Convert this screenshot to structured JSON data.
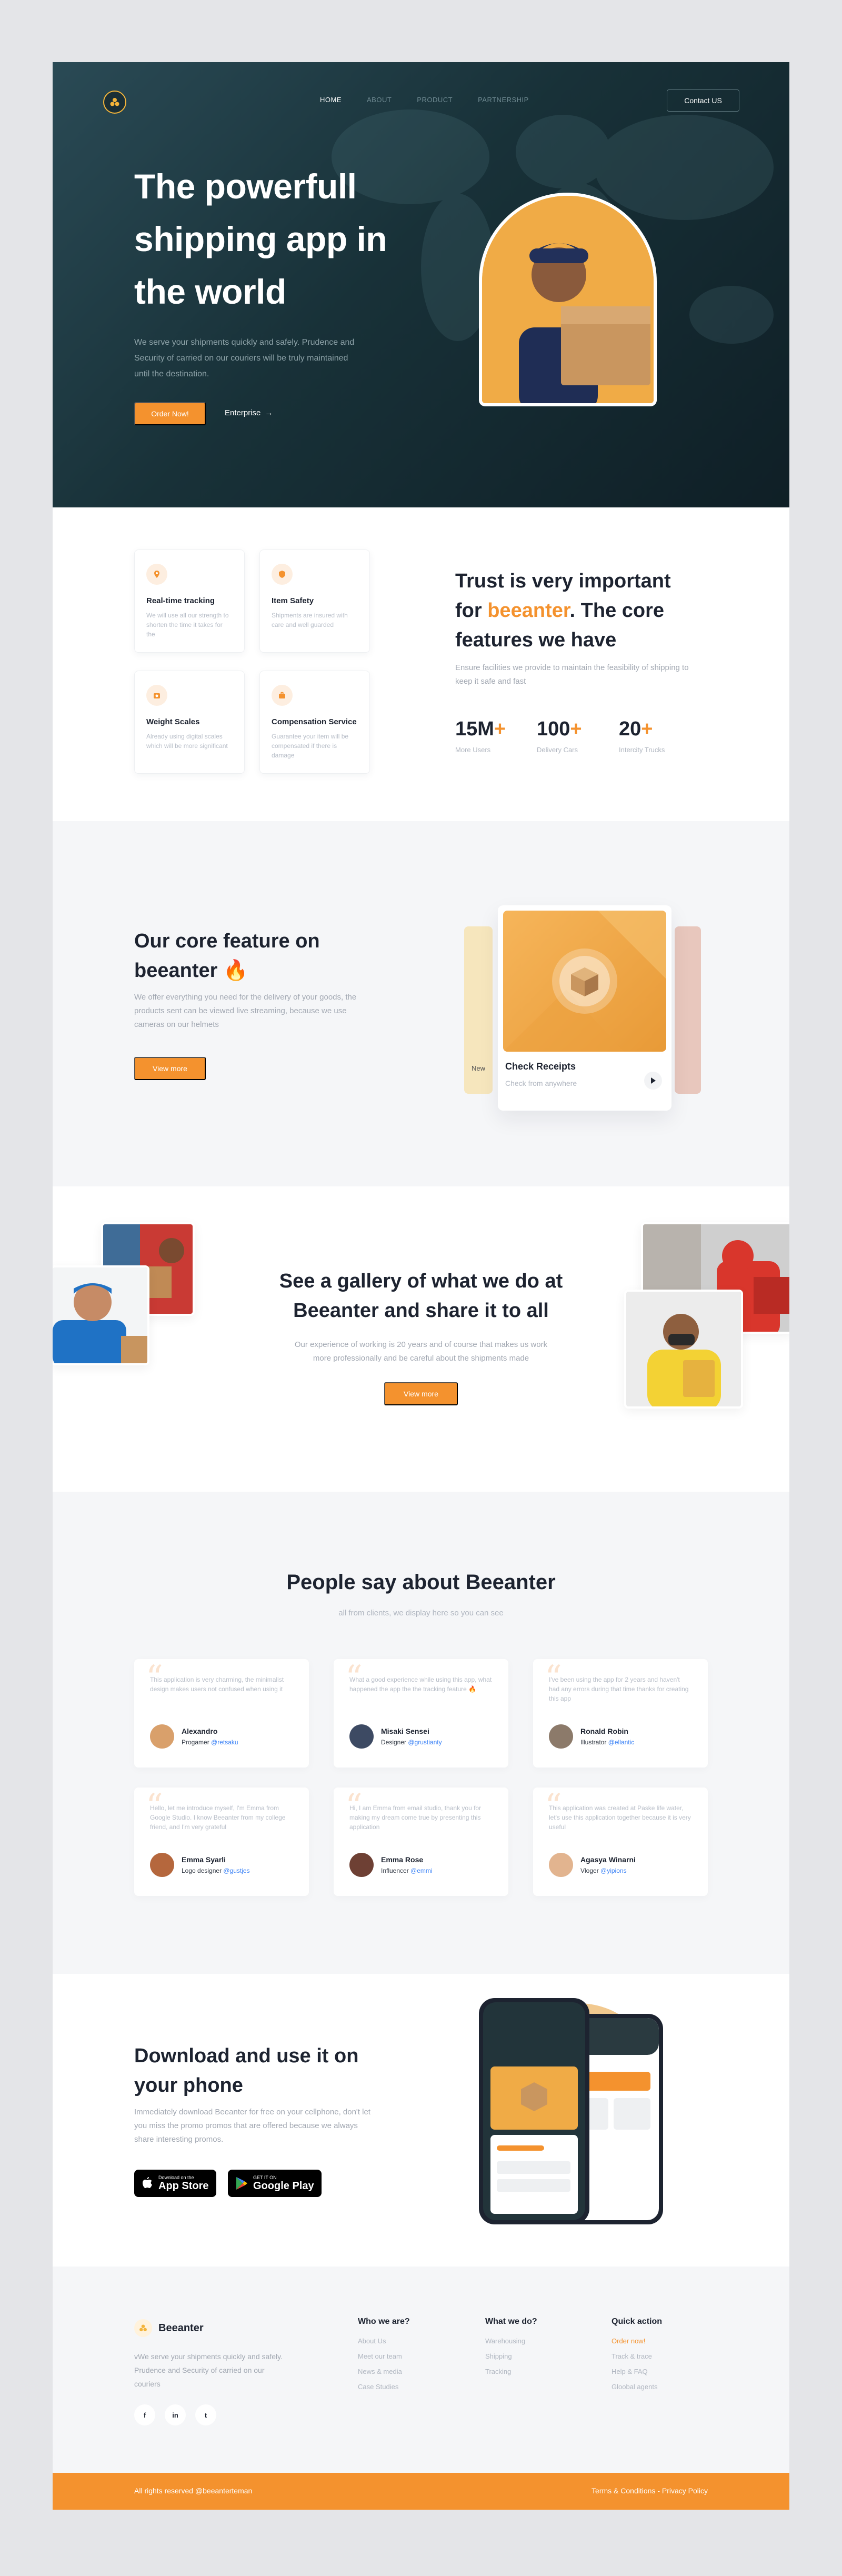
{
  "nav": {
    "links": [
      "HOME",
      "ABOUT",
      "PRODUCT",
      "PARTNERSHIP"
    ],
    "contact_label": "Contact US"
  },
  "hero": {
    "title": "The powerfull shipping app in the world",
    "description": "We serve your shipments quickly and safely. Prudence and Security of carried on our couriers will be truly maintained until the destination.",
    "order_label": "Order Now!",
    "enterprise_label": "Enterprise",
    "arrow": "→"
  },
  "features": [
    {
      "title": "Real-time tracking",
      "desc": "We will use all our strength to shorten the time it takes for the",
      "icon": "location-pin-icon"
    },
    {
      "title": "Item Safety",
      "desc": "Shipments are insured with care and well guarded",
      "icon": "shield-icon"
    },
    {
      "title": "Weight Scales",
      "desc": "Already using digital scales which will be more significant",
      "icon": "scale-icon"
    },
    {
      "title": "Compensation Service",
      "desc": "Guarantee your item will be compensated if there is damage",
      "icon": "briefcase-icon"
    }
  ],
  "trust": {
    "title_a": "Trust is very important for",
    "title_brand": "beeanter",
    "title_b": ". The core features we have",
    "description": "Ensure facilities we provide to maintain the feasibility of shipping to keep it safe and fast",
    "stats": [
      {
        "value": "15M",
        "plus": "+",
        "label": "More Users"
      },
      {
        "value": "100",
        "plus": "+",
        "label": "Delivery Cars"
      },
      {
        "value": "20",
        "plus": "+",
        "label": "Intercity Trucks"
      }
    ]
  },
  "core": {
    "title": "Our core feature on beeanter 🔥",
    "description": "We offer everything you need for the delivery of your goods, the products sent can be viewed live streaming, because we use cameras on our helmets",
    "button_label": "View more",
    "card_title": "Check Receipts",
    "card_sub": "Check from anywhere",
    "back_card_text": "New"
  },
  "gallery": {
    "title": "See a gallery of what we do at Beeanter and share it to all",
    "description": "Our experience of working is 20 years and of course that makes us work more professionally and be careful about the shipments made",
    "button_label": "View more"
  },
  "testimonials": {
    "title": "People say about Beeanter",
    "subtitle": "all from clients, we display here so you can see",
    "items": [
      {
        "text": "This application is very charming, the minimalist design makes users not confused when using it",
        "name": "Alexandro",
        "role": "Progamer",
        "handle": "@retsaku",
        "avatar_color": "#d9a06b"
      },
      {
        "text": "What a good experience while using this app, what happened the app the the tracking feature 🔥",
        "name": "Misaki Sensei",
        "role": "Designer",
        "handle": "@grustianty",
        "avatar_color": "#3d4a63"
      },
      {
        "text": "I've been using the app for 2 years and haven't had any errors during that time thanks for creating this app",
        "name": "Ronald Robin",
        "role": "Illustrator",
        "handle": "@ellantic",
        "avatar_color": "#8c7a6a"
      },
      {
        "text": "Hello, let me introduce myself, I'm Emma from Google Studio. I know Beeanter from my college friend, and I'm very grateful",
        "name": "Emma Syarli",
        "role": "Logo designer",
        "handle": "@gustjes",
        "avatar_color": "#b5673d"
      },
      {
        "text": "Hi, I am Emma from email studio, thank you for making my dream come true by presenting this application",
        "name": "Emma Rose",
        "role": "Influencer",
        "handle": "@emmi",
        "avatar_color": "#6e4034"
      },
      {
        "text": "This application was created at Paske life water, let's use this application together because it is very useful",
        "name": "Agasya Winarni",
        "role": "Vloger",
        "handle": "@yipions",
        "avatar_color": "#e2b48f"
      }
    ]
  },
  "download": {
    "title": "Download and use it on your phone",
    "description": "Immediately download Beeanter for free on your cellphone, don't let you miss the promo promos that are offered because we always share interesting promos.",
    "appstore_small": "Download on the",
    "appstore_big": "App Store",
    "play_small": "GET IT ON",
    "play_big": "Google Play"
  },
  "footer": {
    "brand": "Beeanter",
    "description": "vWe serve your shipments quickly and safely. Prudence and Security of carried on our couriers",
    "socials": [
      "f",
      "in",
      "t"
    ],
    "columns": [
      {
        "title": "Who we are?",
        "items": [
          "About Us",
          "Meet our team",
          "News & media",
          "Case Studies"
        ]
      },
      {
        "title": "What we do?",
        "items": [
          "Warehousing",
          "Shipping",
          "Tracking"
        ]
      },
      {
        "title": "Quick action",
        "items": [
          "Order now!",
          "Track & trace",
          "Help & FAQ",
          "Gloobal agents"
        ]
      }
    ],
    "copyright": "All rights reserved @beeanterteman",
    "legal": "Terms & Conditions - Privacy Policy"
  }
}
